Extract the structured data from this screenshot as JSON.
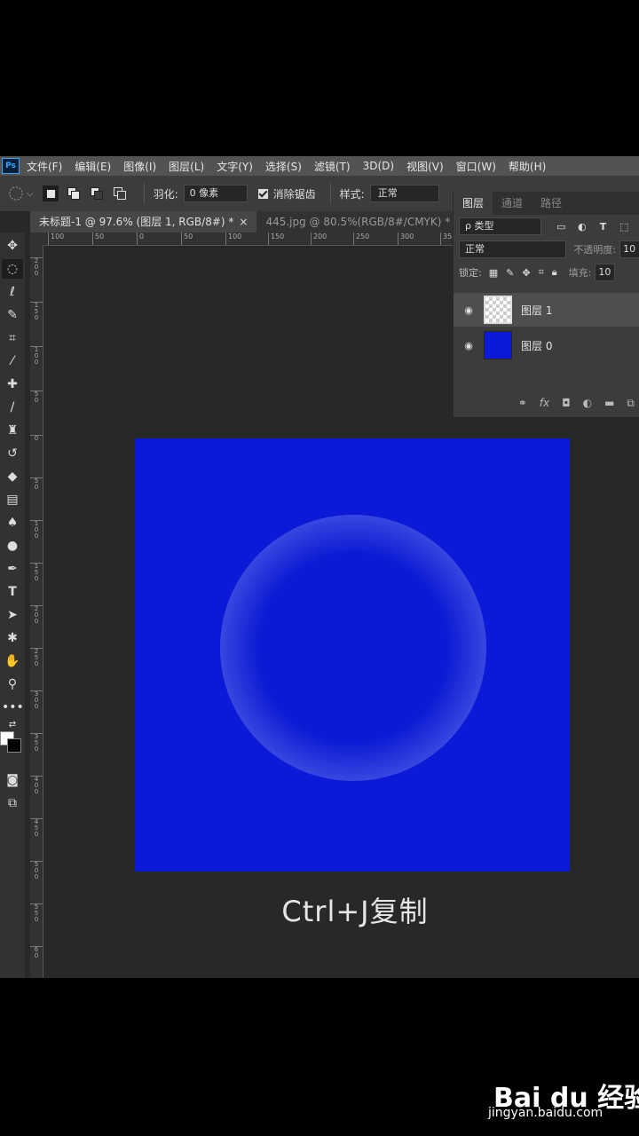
{
  "menubar": {
    "logo": "Ps",
    "items": [
      "文件(F)",
      "编辑(E)",
      "图像(I)",
      "图层(L)",
      "文字(Y)",
      "选择(S)",
      "滤镜(T)",
      "3D(D)",
      "视图(V)",
      "窗口(W)",
      "帮助(H)"
    ]
  },
  "options": {
    "feather_label": "羽化:",
    "feather_value": "0 像素",
    "antialias_label": "消除锯齿",
    "antialias_checked": true,
    "style_label": "样式:",
    "style_value": "正常"
  },
  "tabs": [
    {
      "label": "未标题-1 @ 97.6% (图层 1, RGB/8#) *",
      "active": true
    },
    {
      "label": "445.jpg @ 80.5%(RGB/8#/CMYK) *",
      "active": false
    }
  ],
  "hruler": [
    "100",
    "50",
    "0",
    "50",
    "100",
    "150",
    "200",
    "250",
    "300",
    "35"
  ],
  "vruler": [
    "2\n0\n0",
    "1\n5\n0",
    "1\n0\n0",
    "5\n0",
    "0",
    "5\n0",
    "1\n0\n0",
    "1\n5\n0",
    "2\n0\n0",
    "2\n5\n0",
    "3\n0\n0",
    "3\n5\n0",
    "4\n0\n0",
    "4\n5\n0",
    "5\n0\n0",
    "5\n5\n0",
    "6\n0"
  ],
  "layers_panel": {
    "tabs": [
      "图层",
      "通道",
      "路径"
    ],
    "filter_label": "ρ 类型",
    "blend_mode": "正常",
    "opacity_label": "不透明度:",
    "opacity_value": "10",
    "lock_label": "锁定:",
    "fill_label": "填充:",
    "fill_value": "10",
    "layers": [
      {
        "name": "图层 1",
        "selected": true,
        "thumb": "transparent"
      },
      {
        "name": "图层 0",
        "selected": false,
        "thumb": "blue"
      }
    ]
  },
  "canvas": {
    "fill_color": "#0a1ad6"
  },
  "caption": "Ctrl+J复制",
  "watermark": {
    "brand": "Bai du 经验",
    "url": "jingyan.baidu.com"
  }
}
